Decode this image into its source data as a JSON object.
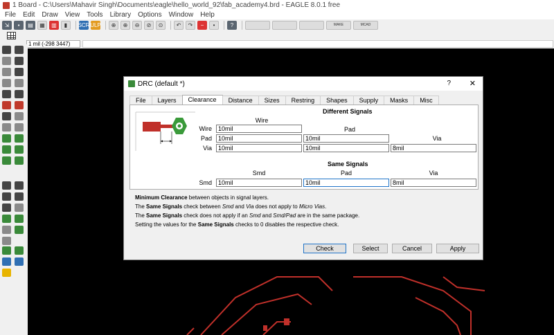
{
  "app": {
    "title": "1 Board - C:\\Users\\Mahavir Singh\\Documents\\eagle\\hello_world_92\\fab_academy4.brd - EAGLE 8.0.1 free",
    "menu": [
      "File",
      "Edit",
      "Draw",
      "View",
      "Tools",
      "Library",
      "Options",
      "Window",
      "Help"
    ],
    "coordinate": "1 mil (-298 3447)",
    "toolbar_labels": {
      "scr": "SCR",
      "ulp": "ULP",
      "make": "MAKE",
      "mcad": "MCAD"
    }
  },
  "dialog": {
    "title": "DRC (default *)",
    "help": "?",
    "close": "✕",
    "tabs": [
      "File",
      "Layers",
      "Clearance",
      "Distance",
      "Sizes",
      "Restring",
      "Shapes",
      "Supply",
      "Masks",
      "Misc"
    ],
    "active_tab": "Clearance",
    "different_signals": {
      "heading": "Different Signals",
      "col_wire": "Wire",
      "col_pad": "Pad",
      "col_via": "Via",
      "row_wire": "Wire",
      "row_pad": "Pad",
      "row_via": "Via",
      "wire_wire": "10mil",
      "pad_wire": "10mil",
      "pad_pad": "10mil",
      "via_wire": "10mil",
      "via_pad": "10mil",
      "via_via": "8mil"
    },
    "same_signals": {
      "heading": "Same Signals",
      "col_smd": "Smd",
      "col_pad": "Pad",
      "col_via": "Via",
      "row_smd": "Smd",
      "smd_smd": "10mil",
      "smd_pad": "10mil",
      "smd_via": "8mil"
    },
    "notes": {
      "n1_bold": "Minimum Clearance",
      "n1_rest": " between objects in signal layers.",
      "n2_a": "The ",
      "n2_b": "Same Signals",
      "n2_c": " check between ",
      "n2_d": "Smd",
      "n2_e": " and ",
      "n2_f": "Via",
      "n2_g": " does not apply to ",
      "n2_h": "Micro Vias",
      "n2_i": ".",
      "n3_a": "The ",
      "n3_b": "Same Signals",
      "n3_c": " check does not apply if an ",
      "n3_d": "Smd",
      "n3_e": " and ",
      "n3_f": "Smd/Pad",
      "n3_g": " are in the same package.",
      "n4_a": "Setting the values for the ",
      "n4_b": "Same Signals",
      "n4_c": " checks to 0 disables the respective check."
    },
    "buttons": {
      "check": "Check",
      "select": "Select",
      "cancel": "Cancel",
      "apply": "Apply"
    }
  },
  "colors": {
    "trace": "#c0302a",
    "canvas": "#000000",
    "pad_green": "#3a9a3a"
  }
}
